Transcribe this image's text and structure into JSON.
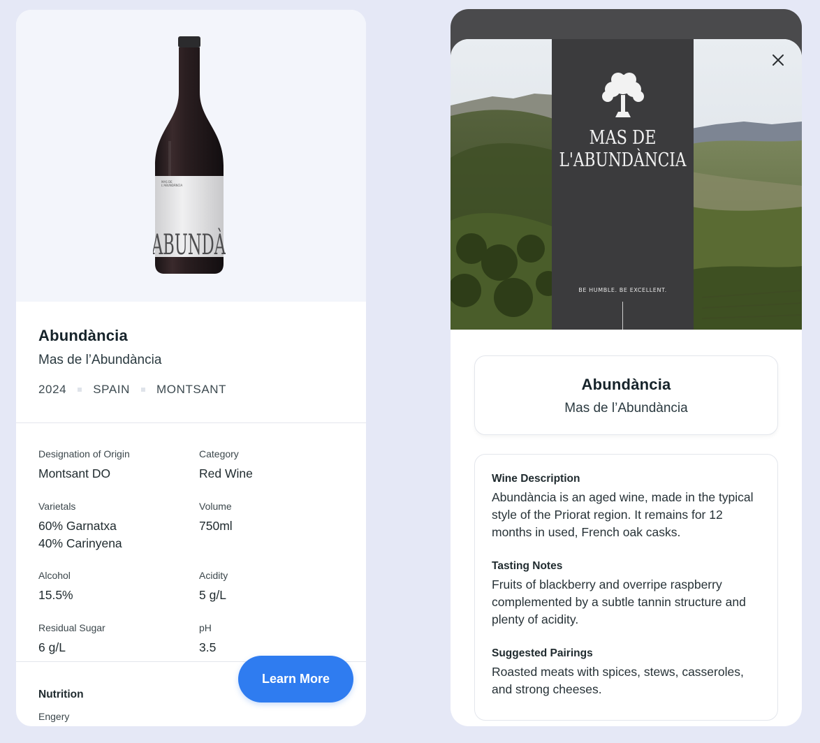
{
  "wine": {
    "name": "Abundància",
    "producer": "Mas de l’Abundància",
    "year": "2024",
    "country": "SPAIN",
    "region": "MONTSANT"
  },
  "bottle_label": {
    "small_text_1": "MAS DE",
    "small_text_2": "L'ABUNDÀNCIA",
    "big_text": "ABUNDÀ"
  },
  "specs": [
    {
      "label": "Designation of Origin",
      "value": "Montsant DO"
    },
    {
      "label": "Category",
      "value": "Red Wine"
    },
    {
      "label": "Varietals",
      "value": "60% Garnatxa\n40% Carinyena"
    },
    {
      "label": "Volume",
      "value": "750ml"
    },
    {
      "label": "Alcohol",
      "value": "15.5%"
    },
    {
      "label": "Acidity",
      "value": "5 g/L"
    },
    {
      "label": "Residual Sugar",
      "value": "6 g/L"
    },
    {
      "label": "pH",
      "value": "3.5"
    }
  ],
  "nutrition": {
    "title": "Nutrition",
    "first_item": "Engery"
  },
  "learn_more_label": "Learn More",
  "hero": {
    "brand_line_1": "MAS DE",
    "brand_line_2": "L'ABUNDÀNCIA",
    "tagline": "BE HUMBLE. BE EXCELLENT."
  },
  "close_icon": "close-icon",
  "description": [
    {
      "title": "Wine Description",
      "text": "Abundància is an aged wine, made in the typical style of the Priorat region. It remains for 12 months in used, French oak casks."
    },
    {
      "title": "Tasting Notes",
      "text": "Fruits of blackberry and overripe raspberry complemented by a subtle tannin structure and plenty of acidity."
    },
    {
      "title": "Suggested Pairings",
      "text": "Roasted meats with spices, stews, casseroles, and strong cheeses."
    }
  ],
  "colors": {
    "background": "#e5e8f6",
    "accent": "#2f7cf0",
    "brand_panel": "#3b3b3d"
  }
}
